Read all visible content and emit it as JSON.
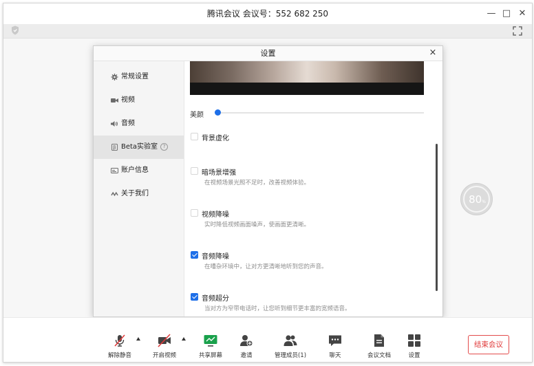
{
  "window": {
    "title": "腾讯会议 会议号：552 682 250",
    "minimize": "—",
    "maximize": "□",
    "close": "✕"
  },
  "settings": {
    "title": "设置",
    "close": "×",
    "sidebar": [
      {
        "label": "常规设置",
        "icon": "gear-icon",
        "active": false
      },
      {
        "label": "视频",
        "icon": "video-camera-icon",
        "active": false
      },
      {
        "label": "音频",
        "icon": "speaker-icon",
        "active": false
      },
      {
        "label": "Beta实验室",
        "icon": "beta-icon",
        "active": true,
        "help": "?"
      },
      {
        "label": "账户信息",
        "icon": "id-card-icon",
        "active": false
      },
      {
        "label": "关于我们",
        "icon": "logo-icon",
        "active": false
      }
    ],
    "beauty": {
      "label": "美颜",
      "value": 0
    },
    "options": [
      {
        "title": "背景虚化",
        "desc": "",
        "checked": false
      },
      {
        "title": "暗场景增强",
        "desc": "在视频场景光照不足时，改善视频体验。",
        "checked": false
      },
      {
        "title": "视频降噪",
        "desc": "实时降低视频画面噪声，使画面更清晰。",
        "checked": false
      },
      {
        "title": "音频降噪",
        "desc": "在嘈杂环境中，让对方更清晰地听到您的声音。",
        "checked": true
      },
      {
        "title": "音频超分",
        "desc": "当对方为窄带电话时，让您听到细节更丰富的宽频语音。",
        "checked": true
      }
    ]
  },
  "network": {
    "value": "80",
    "unit": "%"
  },
  "toolbar": {
    "unmute": "解除静音",
    "start_video": "开启视频",
    "share_screen": "共享屏幕",
    "invite": "邀请",
    "members": "管理成员(1)",
    "chat": "聊天",
    "docs": "会议文档",
    "settings": "设置",
    "end_meeting": "结束会议"
  },
  "colors": {
    "accent": "#1e6fe8",
    "danger": "#e03a3a",
    "share_green": "#1aa14c"
  }
}
